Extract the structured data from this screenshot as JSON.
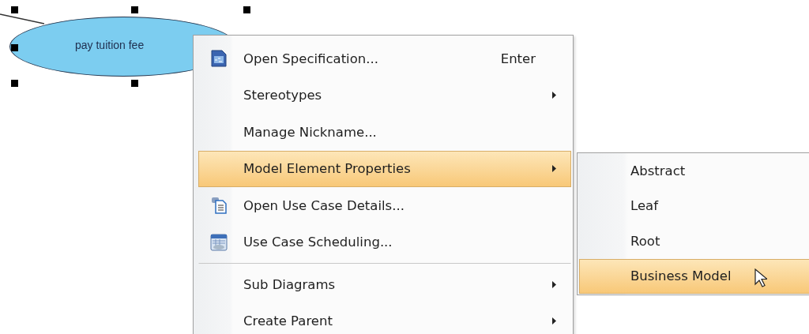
{
  "diagram": {
    "use_case": {
      "label": "pay tuition fee",
      "selected": true
    }
  },
  "context_menu": {
    "items": [
      {
        "label": "Open Specification...",
        "shortcut": "Enter",
        "kind": "spec",
        "submenu": false,
        "selected": false,
        "separator_before": false
      },
      {
        "label": "Stereotypes",
        "kind": "plain",
        "submenu": true,
        "selected": false,
        "separator_before": false
      },
      {
        "label": "Manage Nickname...",
        "kind": "plain",
        "submenu": false,
        "selected": false,
        "separator_before": false
      },
      {
        "label": "Model Element Properties",
        "kind": "plain",
        "submenu": true,
        "selected": true,
        "separator_before": false
      },
      {
        "label": "Open Use Case Details...",
        "kind": "document",
        "submenu": false,
        "selected": false,
        "separator_before": false
      },
      {
        "label": "Use Case Scheduling...",
        "kind": "calendar",
        "submenu": false,
        "selected": false,
        "separator_before": false
      },
      {
        "label": "Sub Diagrams",
        "kind": "plain",
        "submenu": true,
        "selected": false,
        "separator_before": true
      },
      {
        "label": "Create Parent",
        "kind": "plain",
        "submenu": true,
        "selected": false,
        "separator_before": false
      }
    ]
  },
  "submenu": {
    "items": [
      {
        "label": "Abstract",
        "selected": false
      },
      {
        "label": "Leaf",
        "selected": false
      },
      {
        "label": "Root",
        "selected": false
      },
      {
        "label": "Business Model",
        "selected": true
      }
    ]
  }
}
